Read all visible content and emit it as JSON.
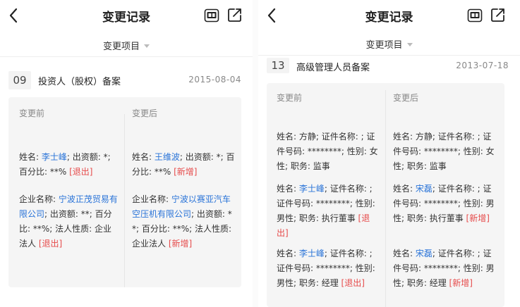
{
  "left_panel": {
    "title": "变更记录",
    "filter_label": "变更项目",
    "record": {
      "index": "09",
      "title": "投资人（股权）备案",
      "date": "2015-08-04",
      "before_label": "变更前",
      "after_label": "变更后",
      "before": [
        {
          "p1": "姓名: ",
          "link": "李士峰",
          "p2": "; 出资额: *; 百分比: **% ",
          "tag": "[退出]"
        },
        {
          "p1": "企业名称: ",
          "link": "宁波正茂贸易有限公司",
          "p2": "; 出资额: **; 百分比: **%; 法人性质: 企业法人 ",
          "tag": "[退出]"
        }
      ],
      "after": [
        {
          "p1": "姓名: ",
          "link": "王维波",
          "p2": "; 出资额: *; 百分比: **% ",
          "tag": "[新增]"
        },
        {
          "p1": "企业名称: ",
          "link": "宁波以赛亚汽车空压机有限公司",
          "p2": "; 出资额: **; 百分比: **%; 法人性质: 企业法人 ",
          "tag": "[新增]"
        }
      ]
    }
  },
  "right_panel": {
    "title": "变更记录",
    "filter_label": "变更项目",
    "record": {
      "index": "13",
      "title": "高级管理人员备案",
      "date": "2013-07-18",
      "before_label": "变更前",
      "after_label": "变更后",
      "before": [
        {
          "text": "姓名: 方静; 证件名称: ; 证件号码: ********; 性别: 女性; 职务: 监事"
        },
        {
          "p1": "姓名: ",
          "link": "李士峰",
          "p2": "; 证件名称: ; 证件号码: ********; 性别: 男性; 职务: 执行董事 ",
          "tag": "[退出]"
        },
        {
          "p1": "姓名: ",
          "link": "李士峰",
          "p2": "; 证件名称: ; 证件号码: ********; 性别: 男性; 职务: 经理 ",
          "tag": "[退出]"
        }
      ],
      "after": [
        {
          "text": "姓名: 方静; 证件名称: ; 证件号码: ********; 性别: 女性; 职务: 监事"
        },
        {
          "p1": "姓名: ",
          "link": "宋磊",
          "p2": "; 证件名称: ; 证件号码: ********; 性别: 男性; 职务: 执行董事 ",
          "tag": "[新增]"
        },
        {
          "p1": "姓名: ",
          "link": "宋磊",
          "p2": "; 证件名称: ; 证件号码: ********; 性别: 男性; 职务: 经理 ",
          "tag": "[新增]"
        }
      ]
    }
  },
  "icons": {
    "back": "chevron-left-icon",
    "long_image": "long-screenshot-icon",
    "share": "share-icon"
  },
  "colors": {
    "link": "#2a74d8",
    "tag": "#e64b4b",
    "card_bg": "#f5f5f5"
  }
}
